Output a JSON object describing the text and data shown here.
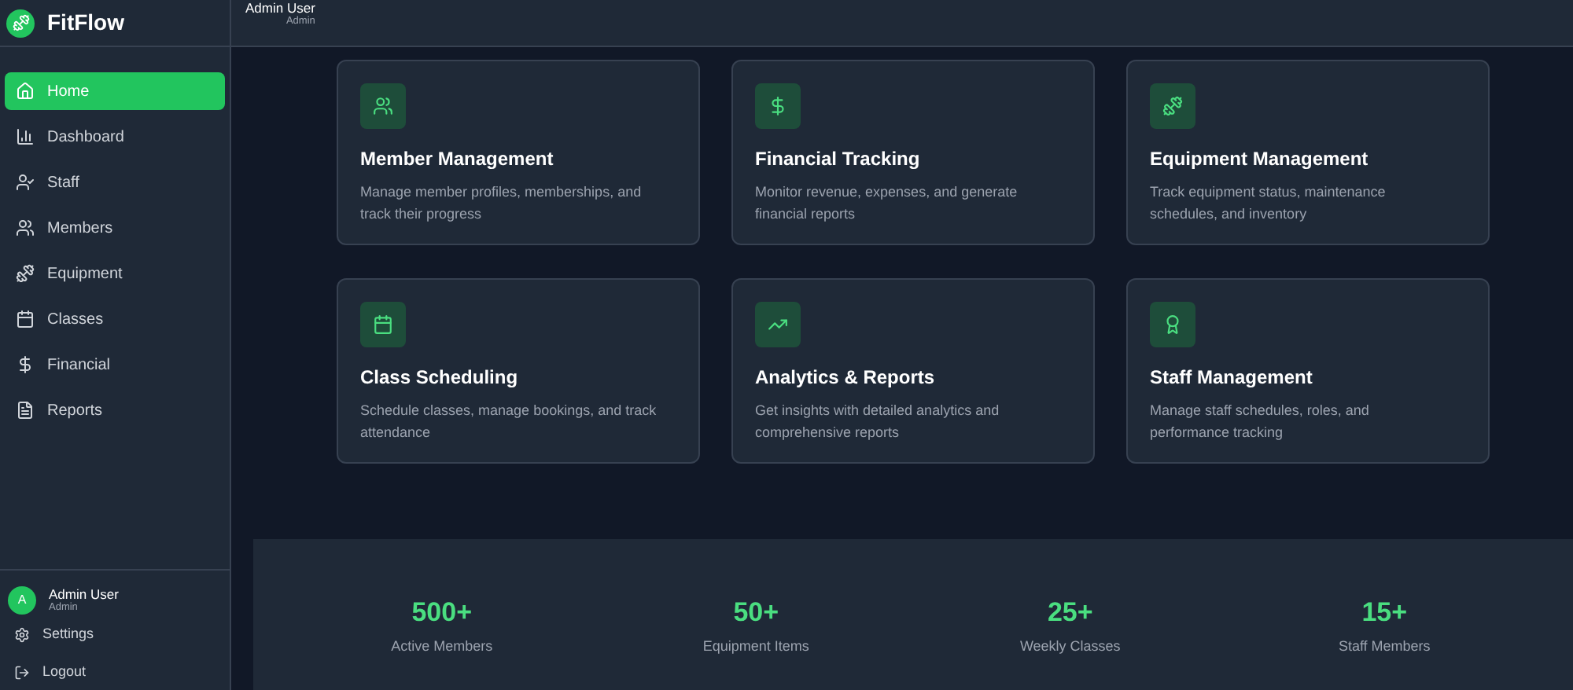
{
  "brand": {
    "name": "FitFlow"
  },
  "header": {
    "user_name": "Admin User",
    "user_role": "Admin"
  },
  "sidebar": {
    "items": [
      {
        "label": "Home",
        "selected": true
      },
      {
        "label": "Dashboard",
        "selected": false
      },
      {
        "label": "Staff",
        "selected": false
      },
      {
        "label": "Members",
        "selected": false
      },
      {
        "label": "Equipment",
        "selected": false
      },
      {
        "label": "Classes",
        "selected": false
      },
      {
        "label": "Financial",
        "selected": false
      },
      {
        "label": "Reports",
        "selected": false
      }
    ],
    "user": {
      "avatar": "A",
      "name": "Admin User",
      "role": "Admin"
    },
    "footer_items": [
      {
        "label": "Settings"
      },
      {
        "label": "Logout"
      }
    ]
  },
  "features": [
    {
      "title": "Member Management",
      "description": "Manage member profiles, memberships, and track their progress"
    },
    {
      "title": "Financial Tracking",
      "description": "Monitor revenue, expenses, and generate financial reports"
    },
    {
      "title": "Equipment Management",
      "description": "Track equipment status, maintenance schedules, and inventory"
    },
    {
      "title": "Class Scheduling",
      "description": "Schedule classes, manage bookings, and track attendance"
    },
    {
      "title": "Analytics & Reports",
      "description": "Get insights with detailed analytics and comprehensive reports"
    },
    {
      "title": "Staff Management",
      "description": "Manage staff schedules, roles, and performance tracking"
    }
  ],
  "stats": [
    {
      "value": "500+",
      "label": "Active Members"
    },
    {
      "value": "50+",
      "label": "Equipment Items"
    },
    {
      "value": "25+",
      "label": "Weekly Classes"
    },
    {
      "value": "15+",
      "label": "Staff Members"
    }
  ]
}
